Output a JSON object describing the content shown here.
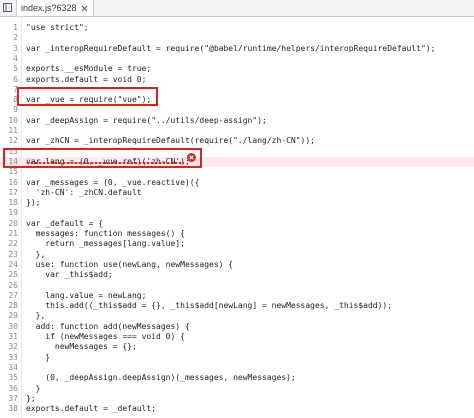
{
  "tab": {
    "filename": "index.js?6328",
    "close_glyph": "×"
  },
  "icons": {
    "sidebar": "panel-toggle-icon",
    "close": "close-icon",
    "error": "error-icon"
  },
  "colors": {
    "highlight_box": "#e02020",
    "error": "#e0241b",
    "error_line_bg": "#fdeaea"
  },
  "code": {
    "lines": [
      {
        "n": "1",
        "text": "\"use strict\";"
      },
      {
        "n": "2",
        "text": ""
      },
      {
        "n": "3",
        "text": "var _interopRequireDefault = require(\"@babel/runtime/helpers/interopRequireDefault\");"
      },
      {
        "n": "4",
        "text": ""
      },
      {
        "n": "5",
        "text": "exports.__esModule = true;"
      },
      {
        "n": "6",
        "text": "exports.default = void 0;"
      },
      {
        "n": "7",
        "text": ""
      },
      {
        "n": "8",
        "text": "var _vue = require(\"vue\");"
      },
      {
        "n": "9",
        "text": ""
      },
      {
        "n": "10",
        "text": "var _deepAssign = require(\"../utils/deep-assign\");"
      },
      {
        "n": "11",
        "text": ""
      },
      {
        "n": "12",
        "text": "var _zhCN = _interopRequireDefault(require(\"./lang/zh-CN\"));"
      },
      {
        "n": "13",
        "text": ""
      },
      {
        "n": "14",
        "text": "var lang = (0, _vue.ref)('zh-CN');"
      },
      {
        "n": "15",
        "text": ""
      },
      {
        "n": "16",
        "text": "var _messages = (0, _vue.reactive)({"
      },
      {
        "n": "17",
        "text": "  'zh-CN': _zhCN.default"
      },
      {
        "n": "18",
        "text": "});"
      },
      {
        "n": "19",
        "text": ""
      },
      {
        "n": "20",
        "text": "var _default = {"
      },
      {
        "n": "21",
        "text": "  messages: function messages() {"
      },
      {
        "n": "22",
        "text": "    return _messages[lang.value];"
      },
      {
        "n": "23",
        "text": "  },"
      },
      {
        "n": "24",
        "text": "  use: function use(newLang, newMessages) {"
      },
      {
        "n": "25",
        "text": "    var _this$add;"
      },
      {
        "n": "26",
        "text": ""
      },
      {
        "n": "27",
        "text": "    lang.value = newLang;"
      },
      {
        "n": "28",
        "text": "    this.add((_this$add = {}, _this$add[newLang] = newMessages, _this$add));"
      },
      {
        "n": "29",
        "text": "  },"
      },
      {
        "n": "30",
        "text": "  add: function add(newMessages) {"
      },
      {
        "n": "31",
        "text": "    if (newMessages === void 0) {"
      },
      {
        "n": "32",
        "text": "      newMessages = {};"
      },
      {
        "n": "33",
        "text": "    }"
      },
      {
        "n": "34",
        "text": ""
      },
      {
        "n": "35",
        "text": "    (0, _deepAssign.deepAssign)(_messages, newMessages);"
      },
      {
        "n": "36",
        "text": "  }"
      },
      {
        "n": "37",
        "text": "};"
      },
      {
        "n": "38",
        "text": "exports.default = _default;"
      }
    ]
  }
}
